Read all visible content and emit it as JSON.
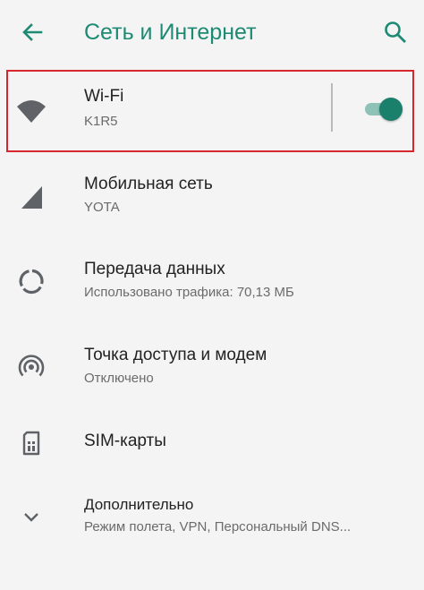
{
  "header": {
    "title": "Сеть и Интернет",
    "back_icon": "arrow-back-icon",
    "search_icon": "search-icon"
  },
  "items": [
    {
      "label": "Wi-Fi",
      "sub": "K1R5",
      "icon": "wifi-icon",
      "toggle_on": true
    },
    {
      "label": "Мобильная сеть",
      "sub": "YOTA",
      "icon": "signal-icon"
    },
    {
      "label": "Передача данных",
      "sub": "Использовано трафика: 70,13 МБ",
      "icon": "data-usage-icon"
    },
    {
      "label": "Точка доступа и модем",
      "sub": "Отключено",
      "icon": "hotspot-icon"
    },
    {
      "label": "SIM-карты",
      "icon": "sim-card-icon"
    },
    {
      "label": "Дополнительно",
      "sub": "Режим полета, VPN, Персональный DNS...",
      "icon": "chevron-down-icon"
    }
  ],
  "colors": {
    "accent": "#1e8a74",
    "toggle_thumb": "#1a7f6b",
    "toggle_track": "#8ec2b7",
    "highlight": "#d6262e",
    "icon": "#5f6368"
  }
}
